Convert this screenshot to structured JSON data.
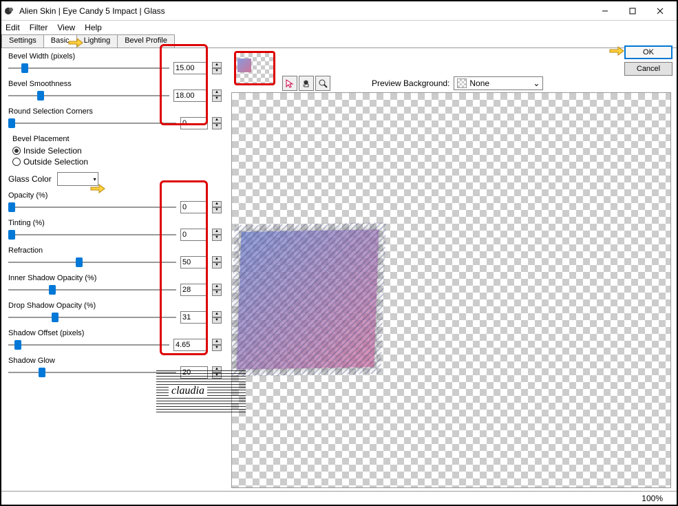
{
  "window": {
    "title": "Alien Skin | Eye Candy 5 Impact | Glass"
  },
  "menu": {
    "edit": "Edit",
    "filter": "Filter",
    "view": "View",
    "help": "Help"
  },
  "tabs": {
    "settings": "Settings",
    "basic": "Basic",
    "lighting": "Lighting",
    "bevel_profile": "Bevel Profile"
  },
  "params": {
    "bevel_width": {
      "label": "Bevel Width (pixels)",
      "value": "15.00",
      "pos": 8
    },
    "bevel_smoothness": {
      "label": "Bevel Smoothness",
      "value": "18.00",
      "pos": 18
    },
    "round_corners": {
      "label": "Round Selection Corners",
      "value": "0",
      "pos": 0
    },
    "bevel_placement": {
      "label": "Bevel Placement",
      "inside": "Inside Selection",
      "outside": "Outside Selection"
    },
    "glass_color": {
      "label": "Glass Color"
    },
    "opacity": {
      "label": "Opacity (%)",
      "value": "0",
      "pos": 0
    },
    "tinting": {
      "label": "Tinting (%)",
      "value": "0",
      "pos": 0
    },
    "refraction": {
      "label": "Refraction",
      "value": "50",
      "pos": 40
    },
    "inner_shadow": {
      "label": "Inner Shadow Opacity (%)",
      "value": "28",
      "pos": 24
    },
    "drop_shadow": {
      "label": "Drop Shadow Opacity (%)",
      "value": "31",
      "pos": 26
    },
    "shadow_offset": {
      "label": "Shadow Offset (pixels)",
      "value": "4.65",
      "pos": 4
    },
    "shadow_glow": {
      "label": "Shadow Glow",
      "value": "20",
      "pos": 18
    }
  },
  "preview": {
    "bg_label": "Preview Background:",
    "bg_value": "None"
  },
  "actions": {
    "ok": "OK",
    "cancel": "Cancel"
  },
  "status": {
    "zoom": "100%"
  },
  "watermark": {
    "text": "claudia"
  }
}
